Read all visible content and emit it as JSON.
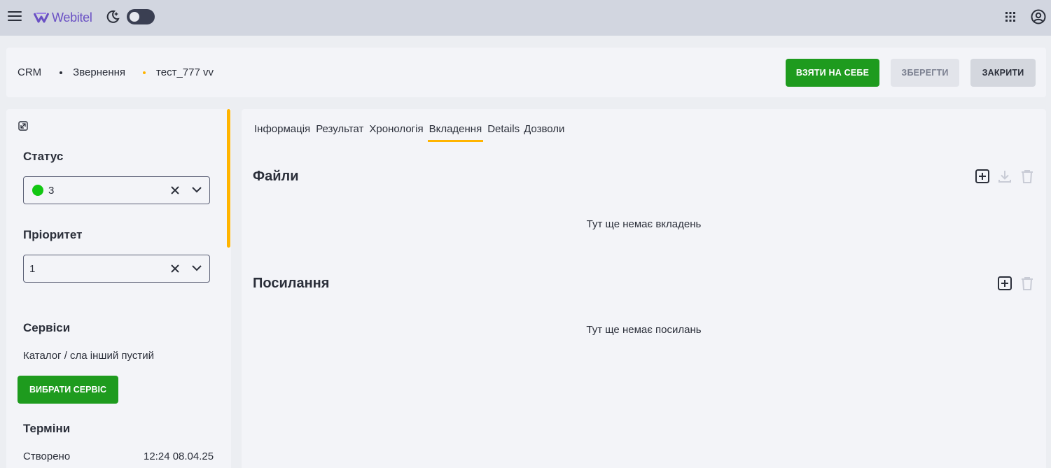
{
  "topbar": {
    "brand": "Webitel",
    "icons": [
      "menu-icon",
      "webitel-logo",
      "moon-icon",
      "apps-grid-icon",
      "user-account-icon"
    ]
  },
  "header": {
    "breadcrumbs": [
      "CRM",
      "Звернення",
      "тест_777 vv"
    ],
    "take_label": "ВЗЯТИ НА СЕБЕ",
    "save_label": "ЗБЕРЕГТИ",
    "close_label": "ЗАКРИТИ"
  },
  "sidebar": {
    "status_label": "Статус",
    "status_value": "3",
    "status_color": "#12c712",
    "priority_label": "Пріоритет",
    "priority_value": "1",
    "services_label": "Сервіси",
    "services_value": "Каталог / сла інший пустий",
    "choose_service_label": "ВИБРАТИ СЕРВІС",
    "terms_label": "Терміни",
    "created_label": "Створено",
    "created_value": "12:24 08.04.25"
  },
  "main": {
    "tabs": [
      {
        "label": "Інформація"
      },
      {
        "label": "Результат"
      },
      {
        "label": "Хронологія"
      },
      {
        "label": "Вкладення",
        "active": true
      },
      {
        "label": "Details"
      },
      {
        "label": "Дозволи"
      }
    ],
    "files_title": "Файли",
    "files_empty": "Тут ще немає вкладень",
    "links_title": "Посилання",
    "links_empty": "Тут ще немає посилань"
  },
  "colors": {
    "accent": "#ffb400",
    "primary_green": "#1e9b1e",
    "brand_purple": "#6a50c4"
  }
}
